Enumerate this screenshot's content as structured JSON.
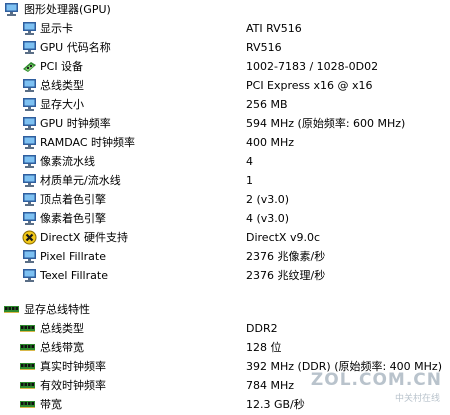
{
  "gpu_section": {
    "title": "图形处理器(GPU)",
    "icon": "monitor-icon",
    "properties": [
      {
        "label": "显示卡",
        "value": "ATI RV516",
        "icon": "monitor-icon"
      },
      {
        "label": "GPU 代码名称",
        "value": "RV516",
        "icon": "monitor-icon"
      },
      {
        "label": "PCI 设备",
        "value": "1002-7183 / 1028-0D02",
        "icon": "pci-card-icon"
      },
      {
        "label": "总线类型",
        "value": "PCI Express x16 @ x16",
        "icon": "monitor-icon"
      },
      {
        "label": "显存大小",
        "value": "256 MB",
        "icon": "monitor-icon"
      },
      {
        "label": "GPU 时钟频率",
        "value": "594 MHz  (原始频率: 600 MHz)",
        "icon": "monitor-icon"
      },
      {
        "label": "RAMDAC 时钟频率",
        "value": "400 MHz",
        "icon": "monitor-icon"
      },
      {
        "label": "像素流水线",
        "value": "4",
        "icon": "monitor-icon"
      },
      {
        "label": "材质单元/流水线",
        "value": "1",
        "icon": "monitor-icon"
      },
      {
        "label": "顶点着色引擎",
        "value": "2  (v3.0)",
        "icon": "monitor-icon"
      },
      {
        "label": "像素着色引擎",
        "value": "4  (v3.0)",
        "icon": "monitor-icon"
      },
      {
        "label": "DirectX 硬件支持",
        "value": "DirectX v9.0c",
        "icon": "directx-icon"
      },
      {
        "label": "Pixel Fillrate",
        "value": "2376 兆像素/秒",
        "icon": "monitor-icon"
      },
      {
        "label": "Texel Fillrate",
        "value": "2376 兆纹理/秒",
        "icon": "monitor-icon"
      }
    ]
  },
  "memory_section": {
    "title": "显存总线特性",
    "icon": "memory-module-icon",
    "properties": [
      {
        "label": "总线类型",
        "value": "DDR2",
        "icon": "memory-module-icon"
      },
      {
        "label": "总线带宽",
        "value": "128 位",
        "icon": "memory-module-icon"
      },
      {
        "label": "真实时钟频率",
        "value": "392 MHz (DDR)  (原始频率: 400 MHz)",
        "icon": "memory-module-icon"
      },
      {
        "label": "有效时钟频率",
        "value": "784 MHz",
        "icon": "memory-module-icon"
      },
      {
        "label": "带宽",
        "value": "12.3 GB/秒",
        "icon": "memory-module-icon"
      }
    ]
  },
  "watermark": {
    "main": "ZOL.COM.CN",
    "sub": "中关村在线"
  },
  "colors": {
    "monitor_frame": "#2f5e9e",
    "monitor_screen": "#7ec1f2",
    "chip_green": "#2d8a2d",
    "directx_yellow": "#f2c81a",
    "watermark": "#b9c3cc"
  }
}
